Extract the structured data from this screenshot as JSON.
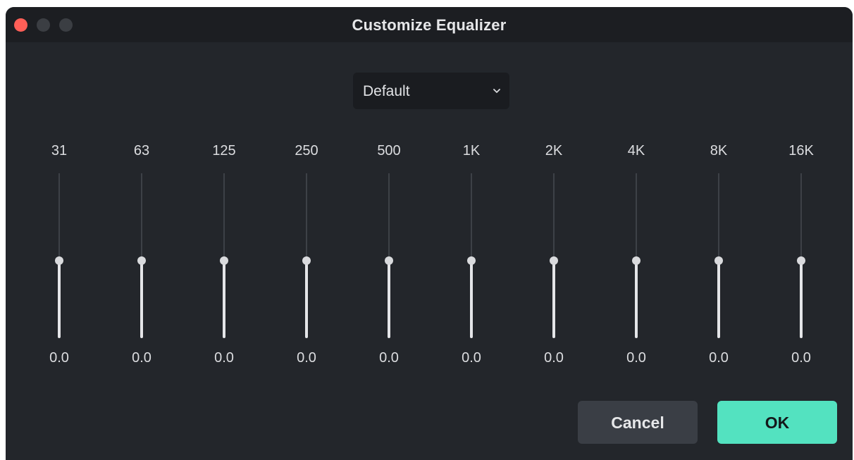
{
  "window": {
    "title": "Customize Equalizer"
  },
  "preset": {
    "selected": "Default",
    "icon": "chevron-down-icon"
  },
  "bands": [
    {
      "freq": "31",
      "value": "0.0",
      "level": 0.47
    },
    {
      "freq": "63",
      "value": "0.0",
      "level": 0.47
    },
    {
      "freq": "125",
      "value": "0.0",
      "level": 0.47
    },
    {
      "freq": "250",
      "value": "0.0",
      "level": 0.47
    },
    {
      "freq": "500",
      "value": "0.0",
      "level": 0.47
    },
    {
      "freq": "1K",
      "value": "0.0",
      "level": 0.47
    },
    {
      "freq": "2K",
      "value": "0.0",
      "level": 0.47
    },
    {
      "freq": "4K",
      "value": "0.0",
      "level": 0.47
    },
    {
      "freq": "8K",
      "value": "0.0",
      "level": 0.47
    },
    {
      "freq": "16K",
      "value": "0.0",
      "level": 0.47
    }
  ],
  "buttons": {
    "cancel": "Cancel",
    "ok": "OK"
  },
  "colors": {
    "accent": "#53e2c0",
    "close": "#ff5f57",
    "background": "#23262b"
  }
}
